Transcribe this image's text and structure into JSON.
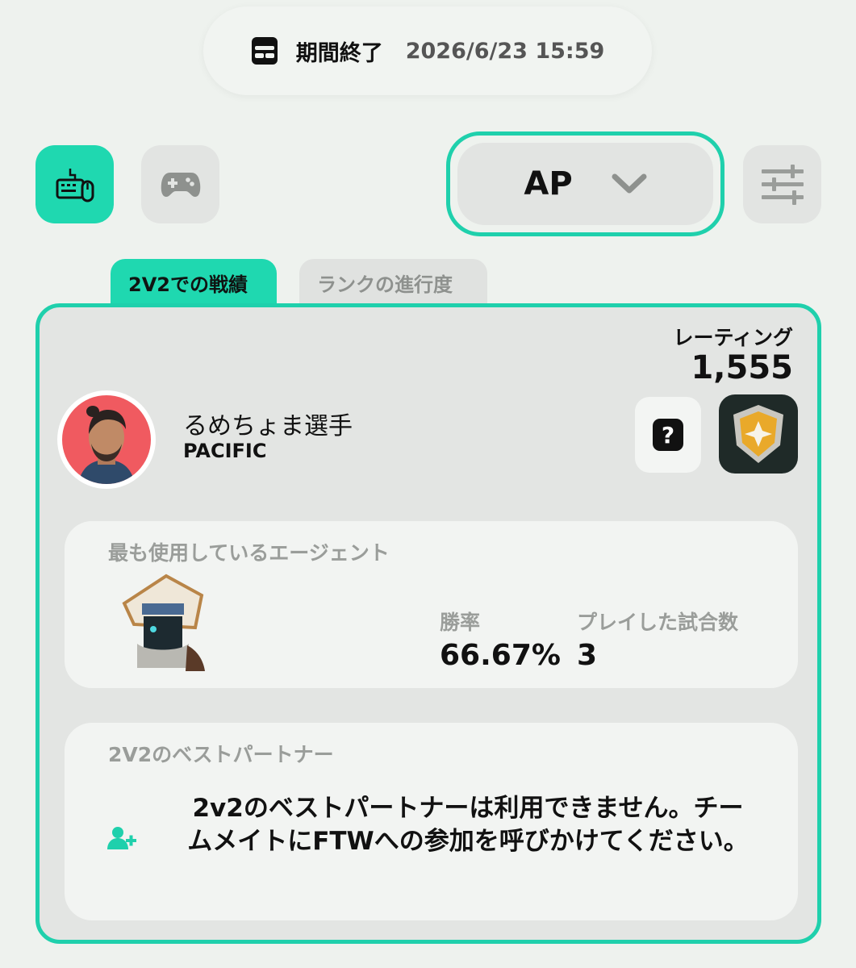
{
  "period": {
    "label": "期間終了",
    "value": "2026/6/23 15:59",
    "icon": "calendar-icon"
  },
  "platforms": [
    {
      "name": "pc",
      "icon": "keyboard-mouse-icon",
      "active": true
    },
    {
      "name": "console",
      "icon": "gamepad-icon",
      "active": false
    }
  ],
  "region": {
    "code": "AP",
    "icon": "chevron-down-icon"
  },
  "filter": {
    "icon": "sliders-icon"
  },
  "tabs": [
    {
      "label": "2V2での戦績",
      "active": true
    },
    {
      "label": "ランクの進行度",
      "active": false
    }
  ],
  "colors": {
    "accent": "#1fd8b0",
    "card_bg": "#e3e5e3",
    "avatar_bg": "#f05a60"
  },
  "player": {
    "name": "るめちょま選手",
    "team": "PACIFIC",
    "rating_label": "レーティング",
    "rating": "1,555",
    "help_icon": "question-icon",
    "rank_icon": "rank-badge-icon"
  },
  "agent": {
    "heading": "最も使用しているエージェント",
    "win_rate_label": "勝率",
    "win_rate": "66.67%",
    "matches_label": "プレイした試合数",
    "matches": "3"
  },
  "partner": {
    "heading": "2V2のベストパートナー",
    "message": "2v2のベストパートナーは利用できません。チームメイトにFTWへの参加を呼びかけてください。",
    "icon": "add-user-icon"
  }
}
